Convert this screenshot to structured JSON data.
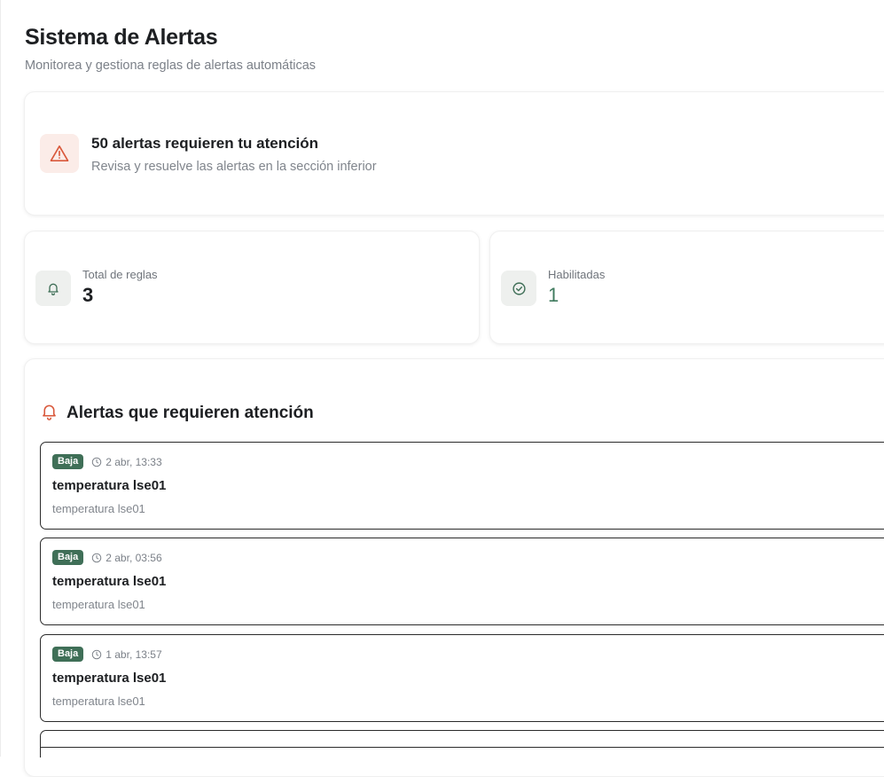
{
  "header": {
    "title": "Sistema de Alertas",
    "subtitle": "Monitorea y gestiona reglas de alertas automáticas"
  },
  "banner": {
    "icon": "warning-triangle-icon",
    "title": "50 alertas requieren tu atención",
    "description": "Revisa y resuelve las alertas en la sección inferior",
    "accent": "#d9583b"
  },
  "stats": [
    {
      "icon": "bell-icon",
      "label": "Total de reglas",
      "value": "3"
    },
    {
      "icon": "check-circle-icon",
      "label": "Habilitadas",
      "value": "1",
      "color": "#3f7a5e"
    }
  ],
  "alerts_section": {
    "icon": "bell-icon",
    "title": "Alertas que requieren atención",
    "items": [
      {
        "severity": "Baja",
        "time": "2 abr, 13:33",
        "title": "temperatura lse01",
        "description": "temperatura lse01"
      },
      {
        "severity": "Baja",
        "time": "2 abr, 03:56",
        "title": "temperatura lse01",
        "description": "temperatura lse01"
      },
      {
        "severity": "Baja",
        "time": "1 abr, 13:57",
        "title": "temperatura lse01",
        "description": "temperatura lse01"
      }
    ]
  },
  "colors": {
    "severity_low": "#3f6f57",
    "accent_red": "#d9583b",
    "muted_text": "#7b8088"
  }
}
